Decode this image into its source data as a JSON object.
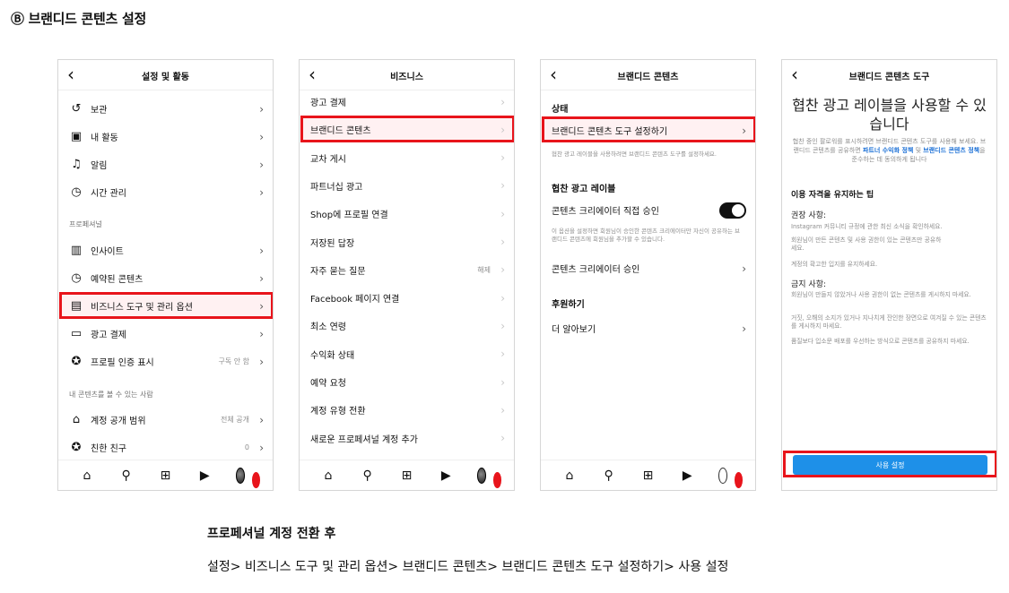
{
  "section_title": "Ⓑ 브랜디드 콘텐츠 설정",
  "screen1": {
    "title": "설정 및 활동",
    "items": [
      {
        "label": "보관",
        "icon": "archive-icon"
      },
      {
        "label": "내 활동",
        "icon": "activity-icon"
      },
      {
        "label": "알림",
        "icon": "bell-icon"
      },
      {
        "label": "시간 관리",
        "icon": "clock-icon"
      }
    ],
    "section_professional": "프로페셔널",
    "pro_items": [
      {
        "label": "인사이트",
        "icon": "chart-icon"
      },
      {
        "label": "예약된 콘텐츠",
        "icon": "clock-icon"
      },
      {
        "label": "비즈니스 도구 및 관리 옵션",
        "icon": "business-icon"
      },
      {
        "label": "광고 결제",
        "icon": "card-icon"
      },
      {
        "label": "프로필 인증 표시",
        "icon": "verified-icon",
        "meta": "구독 안 함"
      }
    ],
    "section_audience": "내 콘텐츠를 볼 수 있는 사람",
    "audience_items": [
      {
        "label": "계정 공개 범위",
        "icon": "lock-icon",
        "meta": "전체 공개"
      },
      {
        "label": "친한 친구",
        "icon": "star-icon",
        "meta": "0"
      }
    ]
  },
  "screen2": {
    "title": "비즈니스",
    "items": [
      {
        "label": "광고 결제"
      },
      {
        "label": "브랜디드 콘텐츠"
      },
      {
        "label": "교차 게시"
      },
      {
        "label": "파트너십 광고"
      },
      {
        "label": "Shop에 프로필 연결"
      },
      {
        "label": "저장된 답장"
      },
      {
        "label": "자주 묻는 질문",
        "meta": "해제"
      },
      {
        "label": "Facebook 페이지 연결"
      },
      {
        "label": "최소 연령"
      },
      {
        "label": "수익화 상태"
      },
      {
        "label": "예약 요청"
      },
      {
        "label": "계정 유형 전환"
      },
      {
        "label": "새로운 프로페셔널 계정 추가"
      }
    ]
  },
  "screen3": {
    "title": "브랜디드 콘텐츠",
    "status_head": "상태",
    "setup_label": "브랜디드 콘텐츠 도구 설정하기",
    "setup_desc": "협찬 광고 레이블을 사용하려면 브랜디드 콘텐츠 도구를 설정하세요.",
    "label_head": "협찬 광고 레이블",
    "approve_direct": "콘텐츠 크리에이터 직접 승인",
    "approve_desc": "이 옵션을 설정하면 회원님이 승인한 콘텐츠 크리에이터만 자신이 공유하는 브랜디드 콘텐츠에 회원님을 추가할 수 있습니다.",
    "approve": "콘텐츠 크리에이터 승인",
    "sponsor_head": "후원하기",
    "learn_more": "더 알아보기"
  },
  "screen4": {
    "title": "브랜디드 콘텐츠 도구",
    "heading": "협찬 광고 레이블을 사용할 수 있습니다",
    "intro_a": "협찬 중인 팔로워를 표시하려면 브랜디드 콘텐츠 도구를 사용해 보세요. 브랜디드 콘텐츠를 공유하면 ",
    "intro_link1": "파트너 수익화 정책",
    "intro_b": " 및 ",
    "intro_link2": "브랜디드 콘텐츠 정책",
    "intro_c": "을 준수하는 데 동의하게 됩니다",
    "tips_title": "이용 자격을 유지하는 팁",
    "recommended_head": "권장 사항:",
    "recommended": [
      "Instagram 커뮤니티 규정에 관한 최신 소식을 확인하세요.",
      "회원님이 만든 콘텐츠 및 사용 권한이 있는 콘텐츠만 공유하세요.",
      "계정의 확고한 입지를 유지하세요."
    ],
    "prohibited_head": "금지 사항:",
    "prohibited": [
      "회원님이 만들지 않았거나 사용 권한이 없는 콘텐츠를 게시하지 마세요.",
      "거짓, 오해의 소지가 있거나 지나치게 잔인한 장면으로 여겨질 수 있는 콘텐츠를 게시하지 마세요.",
      "품질보다 입소문 배포를 우선하는 방식으로 콘텐츠를 공유하지 마세요."
    ],
    "button": "사용 설정"
  },
  "caption": {
    "heading": "프로페셔널 계정 전환 후",
    "path": "설정> 비즈니스 도구 및 관리 옵션> 브랜디드 콘텐츠> 브랜디드 콘텐츠 도구 설정하기> 사용 설정"
  },
  "nav_icons": [
    "home-icon",
    "search-icon",
    "create-icon",
    "reels-icon",
    "profile-icon"
  ],
  "colors": {
    "highlight": "#e8141b",
    "button_blue": "#1e90e8",
    "link_blue": "#1a6fd6"
  }
}
